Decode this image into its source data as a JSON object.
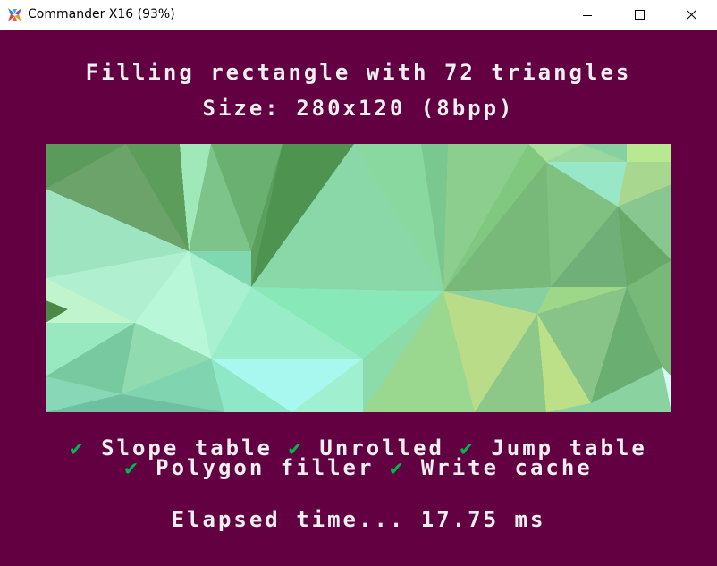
{
  "window": {
    "title": "Commander X16 (93%)",
    "controls": {
      "minimize": "minimize",
      "maximize": "maximize",
      "close": "close"
    }
  },
  "screen": {
    "heading": "Filling rectangle with 72 triangles",
    "size_line": "Size: 280x120 (8bpp)",
    "features": [
      {
        "check": "✔",
        "label": "Slope table"
      },
      {
        "check": "✔",
        "label": "Unrolled"
      },
      {
        "check": "✔",
        "label": "Jump table"
      },
      {
        "check": "✔",
        "label": "Polygon filler"
      },
      {
        "check": "✔",
        "label": "Write cache"
      }
    ],
    "elapsed": "Elapsed time... 17.75 ms"
  },
  "colors": {
    "background": "#620042",
    "text": "#efefef",
    "check": "#00b64c"
  }
}
